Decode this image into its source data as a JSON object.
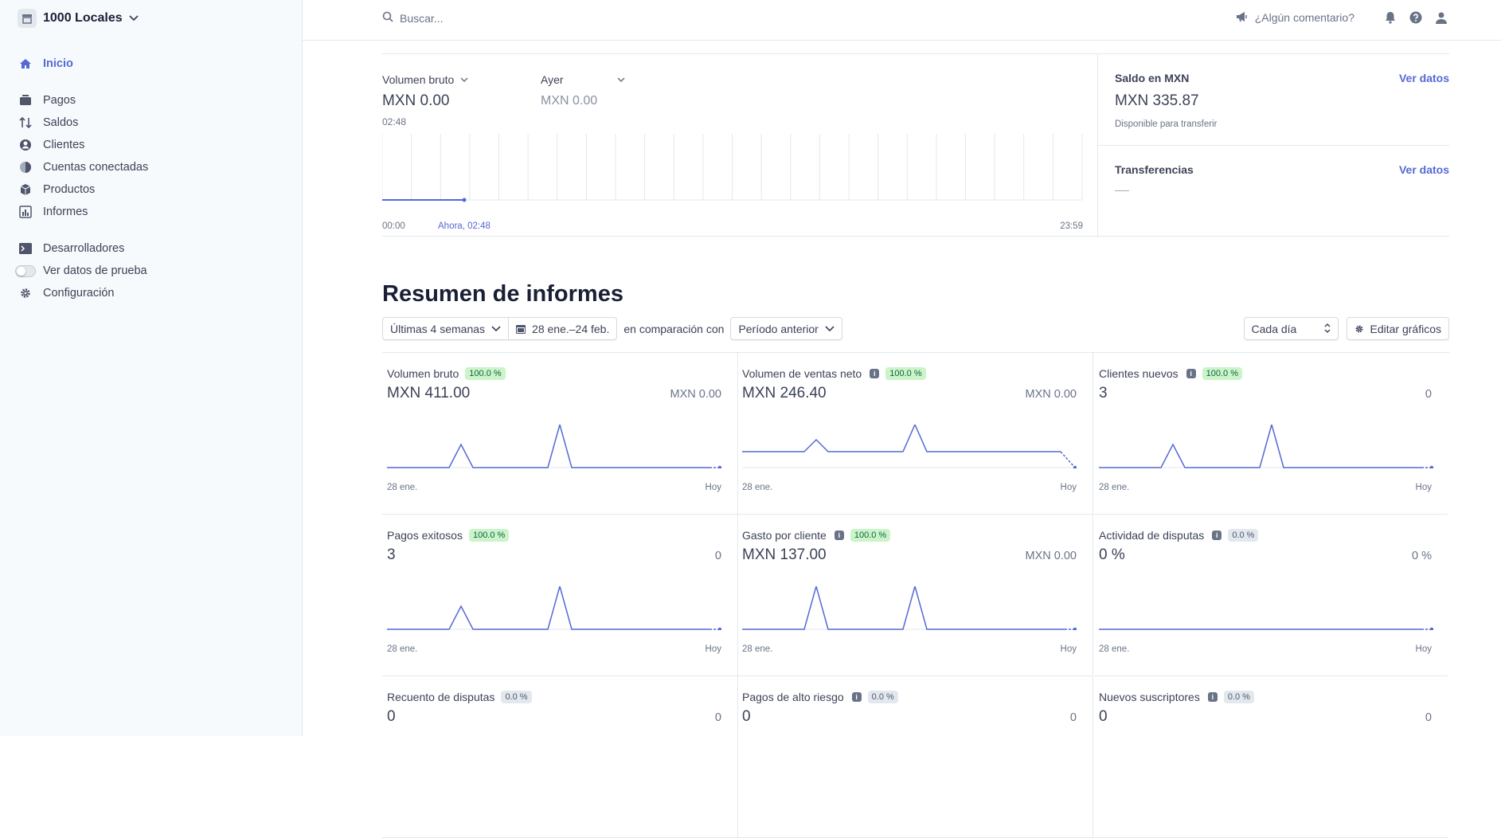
{
  "account": {
    "name": "1000 Locales"
  },
  "sidebar": {
    "home": "Inicio",
    "items": [
      "Pagos",
      "Saldos",
      "Clientes",
      "Cuentas conectadas",
      "Productos",
      "Informes"
    ],
    "developers": "Desarrolladores",
    "test_data": "Ver datos de prueba",
    "settings": "Configuración"
  },
  "topbar": {
    "search_placeholder": "Buscar...",
    "feedback": "¿Algún comentario?"
  },
  "overview": {
    "metric_selector": "Volumen bruto",
    "metric_value": "MXN 0.00",
    "time": "02:48",
    "compare_selector": "Ayer",
    "compare_value": "MXN 0.00",
    "axis_start": "00:00",
    "axis_now": "Ahora, 02:48",
    "axis_end": "23:59"
  },
  "balance": {
    "title": "Saldo en MXN",
    "link": "Ver datos",
    "value": "MXN 335.87",
    "sub": "Disponible para transferir"
  },
  "transfers": {
    "title": "Transferencias",
    "link": "Ver datos"
  },
  "reports": {
    "title": "Resumen de informes",
    "range": "Últimas 4 semanas",
    "dates": "28 ene.–24 feb.",
    "compare_text": "en comparación con",
    "compare_period": "Período anterior",
    "interval": "Cada día",
    "edit": "Editar gráficos"
  },
  "cards": [
    {
      "title": "Volumen bruto",
      "info": false,
      "badge": "100.0 %",
      "badge_type": "g",
      "value": "MXN 411.00",
      "compare": "MXN 0.00",
      "start": "28 ene.",
      "end": "Hoy",
      "shape": "p2"
    },
    {
      "title": "Volumen de ventas neto",
      "info": true,
      "badge": "100.0 %",
      "badge_type": "g",
      "value": "MXN 246.40",
      "compare": "MXN 0.00",
      "start": "28 ene.",
      "end": "Hoy",
      "shape": "net"
    },
    {
      "title": "Clientes nuevos",
      "info": true,
      "badge": "100.0 %",
      "badge_type": "g",
      "value": "3",
      "compare": "0",
      "start": "28 ene.",
      "end": "Hoy",
      "shape": "p2"
    },
    {
      "title": "Pagos exitosos",
      "info": false,
      "badge": "100.0 %",
      "badge_type": "g",
      "value": "3",
      "compare": "0",
      "start": "28 ene.",
      "end": "Hoy",
      "shape": "p2"
    },
    {
      "title": "Gasto por cliente",
      "info": true,
      "badge": "100.0 %",
      "badge_type": "g",
      "value": "MXN 137.00",
      "compare": "MXN 0.00",
      "start": "28 ene.",
      "end": "Hoy",
      "shape": "pp"
    },
    {
      "title": "Actividad de disputas",
      "info": true,
      "badge": "0.0 %",
      "badge_type": "n",
      "value": "0 %",
      "compare": "0 %",
      "start": "28 ene.",
      "end": "Hoy",
      "shape": "flat"
    },
    {
      "title": "Recuento de disputas",
      "info": false,
      "badge": "0.0 %",
      "badge_type": "n",
      "value": "0",
      "compare": "0",
      "start": "",
      "end": "",
      "shape": "none"
    },
    {
      "title": "Pagos de alto riesgo",
      "info": true,
      "badge": "0.0 %",
      "badge_type": "n",
      "value": "0",
      "compare": "0",
      "start": "",
      "end": "",
      "shape": "none"
    },
    {
      "title": "Nuevos suscriptores",
      "info": true,
      "badge": "0.0 %",
      "badge_type": "n",
      "value": "0",
      "compare": "0",
      "start": "",
      "end": "",
      "shape": "none"
    }
  ]
}
